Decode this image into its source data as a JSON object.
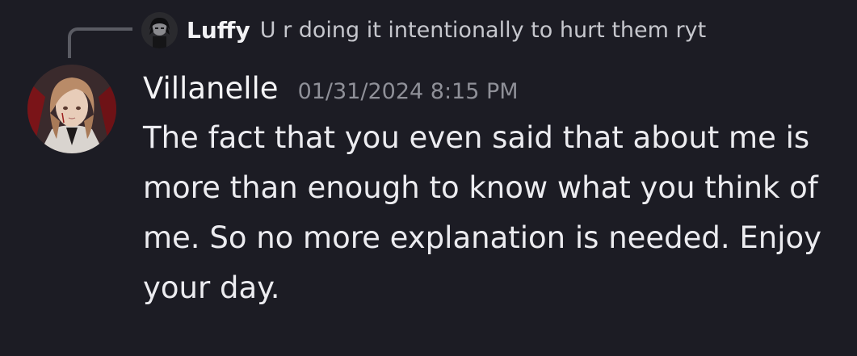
{
  "reply": {
    "author": "Luffy",
    "text": "U r doing it intentionally to hurt them ryt"
  },
  "message": {
    "author": "Villanelle",
    "timestamp": "01/31/2024 8:15 PM",
    "content": "The fact that you even said that about me is more than enough to know what you think of me. So no more explanation is needed. Enjoy your day."
  },
  "colors": {
    "background": "#1c1c24",
    "text": "#ececf0",
    "timestamp": "#8f9098",
    "reply_text": "#c6c7cd",
    "reply_spine": "#5a5b63"
  },
  "icons": {
    "reply_avatar": "dark-haired-character-avatar",
    "author_avatar": "anime-girl-avatar"
  }
}
